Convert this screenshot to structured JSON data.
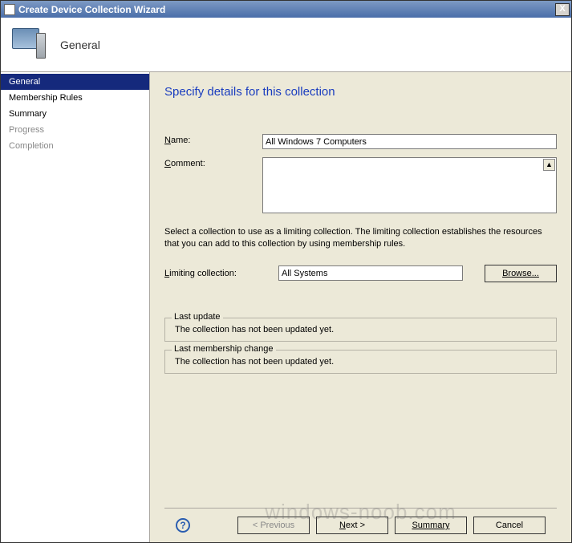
{
  "titlebar": {
    "title": "Create Device Collection Wizard",
    "close": "X"
  },
  "header": {
    "title": "General"
  },
  "sidebar": {
    "items": [
      {
        "label": "General",
        "state": "active"
      },
      {
        "label": "Membership Rules",
        "state": "normal"
      },
      {
        "label": "Summary",
        "state": "normal"
      },
      {
        "label": "Progress",
        "state": "disabled"
      },
      {
        "label": "Completion",
        "state": "disabled"
      }
    ]
  },
  "main": {
    "page_title": "Specify details for this collection",
    "name_label": "Name:",
    "name_value": "All Windows 7 Computers",
    "comment_label": "Comment:",
    "comment_value": "",
    "help_text": "Select a collection to use as a limiting collection. The limiting collection establishes the resources that you can add to this collection by using membership rules.",
    "limiting_label": "Limiting collection:",
    "limiting_value": "All Systems",
    "browse_label": "Browse...",
    "last_update": {
      "legend": "Last update",
      "text": "The collection has not been updated yet."
    },
    "last_membership": {
      "legend": "Last membership change",
      "text": "The collection has not been updated yet."
    }
  },
  "footer": {
    "help": "?",
    "previous": "< Previous",
    "next": "Next >",
    "summary": "Summary",
    "cancel": "Cancel"
  },
  "watermark": "windows-noob.com"
}
